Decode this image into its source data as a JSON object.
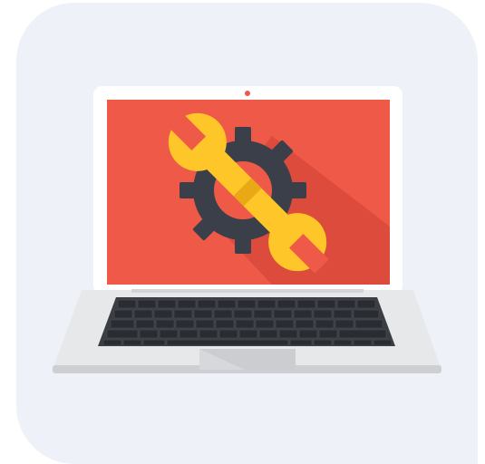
{
  "illustration": {
    "subject": "laptop-maintenance",
    "icon": "wrench-and-gear-icon",
    "colors": {
      "card_background": "#EEF2F8",
      "screen": "#EF5A48",
      "screen_shadow": "#D9493A",
      "bezel": "#FFFFFF",
      "camera": "#EF5A48",
      "gear": "#3A3F4A",
      "wrench": "#FFC629",
      "wrench_shade": "#E8A915",
      "body": "#E7E8EA",
      "body_edge": "#CDCFD3",
      "keyboard": "#3A3D44",
      "keys": "#2A2C31",
      "touchpad": "#D6D8DC"
    }
  }
}
